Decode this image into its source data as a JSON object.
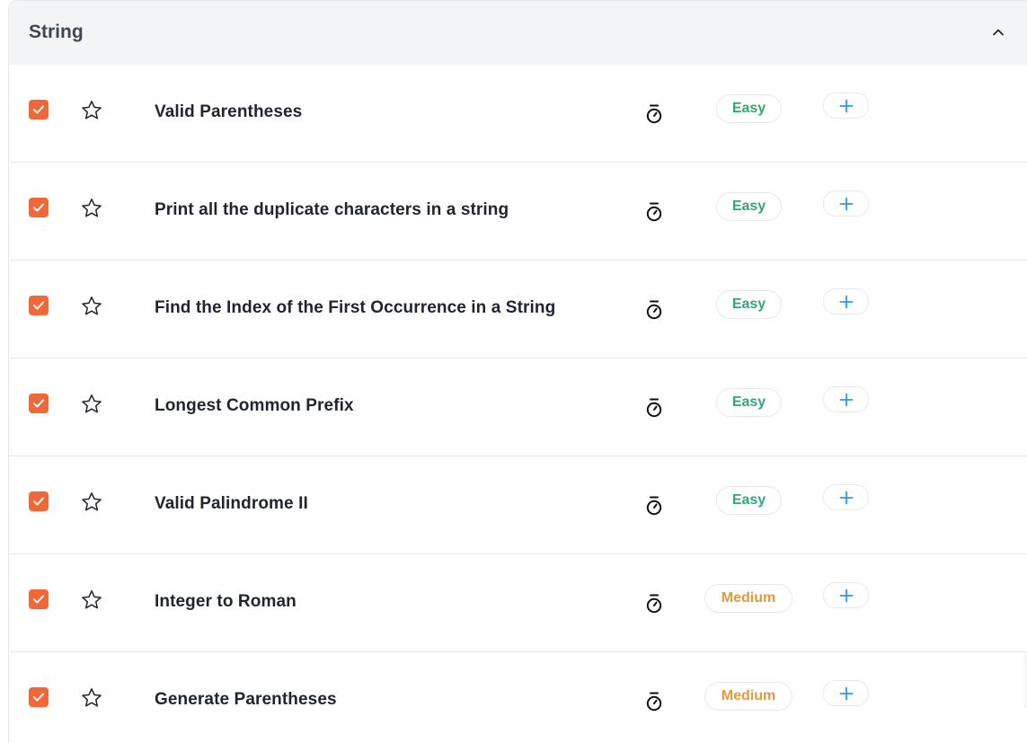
{
  "section": {
    "title": "String"
  },
  "colors": {
    "checkbox": "#f0683a",
    "easy": "#3aa374",
    "medium": "#e09a3c",
    "add_icon": "#2f9ae0"
  },
  "icons": {
    "collapse": "chevron-up-icon",
    "check": "check-icon",
    "favorite": "star-icon",
    "timer": "stopwatch-icon",
    "add": "plus-icon"
  },
  "problems": [
    {
      "title": "Valid Parentheses",
      "difficulty": "Easy",
      "level": "easy",
      "checked": true
    },
    {
      "title": "Print all the duplicate characters in a string",
      "difficulty": "Easy",
      "level": "easy",
      "checked": true
    },
    {
      "title": "Find the Index of the First Occurrence in a String",
      "difficulty": "Easy",
      "level": "easy",
      "checked": true
    },
    {
      "title": "Longest Common Prefix",
      "difficulty": "Easy",
      "level": "easy",
      "checked": true
    },
    {
      "title": "Valid Palindrome II",
      "difficulty": "Easy",
      "level": "easy",
      "checked": true
    },
    {
      "title": "Integer to Roman",
      "difficulty": "Medium",
      "level": "medium",
      "checked": true
    },
    {
      "title": "Generate Parentheses",
      "difficulty": "Medium",
      "level": "medium",
      "checked": true
    }
  ]
}
